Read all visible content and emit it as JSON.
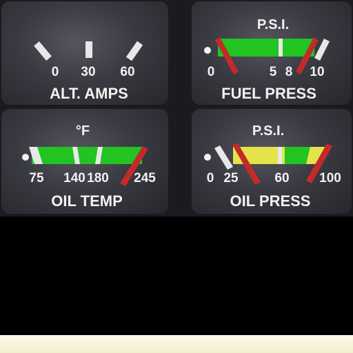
{
  "gauges": {
    "alt_amps": {
      "title": "ALT. AMPS",
      "tick_labels": [
        "0",
        "30",
        "60"
      ]
    },
    "fuel_press": {
      "title": "FUEL PRESS",
      "unit": "P.S.I.",
      "tick_labels": [
        "0",
        "5",
        "8",
        "10"
      ]
    },
    "oil_temp": {
      "title": "OIL TEMP",
      "unit": "°F",
      "tick_labels": [
        "75",
        "140",
        "180",
        "245"
      ]
    },
    "oil_press": {
      "title": "OIL PRESS",
      "unit": "P.S.I.",
      "tick_labels": [
        "0",
        "25",
        "60",
        "100"
      ]
    }
  },
  "colors": {
    "green": "#22c422",
    "yellow": "#e4e44a",
    "red": "#c42a2a",
    "marker": "#e8e8e8",
    "bottom_strip": "#fffbe6"
  }
}
